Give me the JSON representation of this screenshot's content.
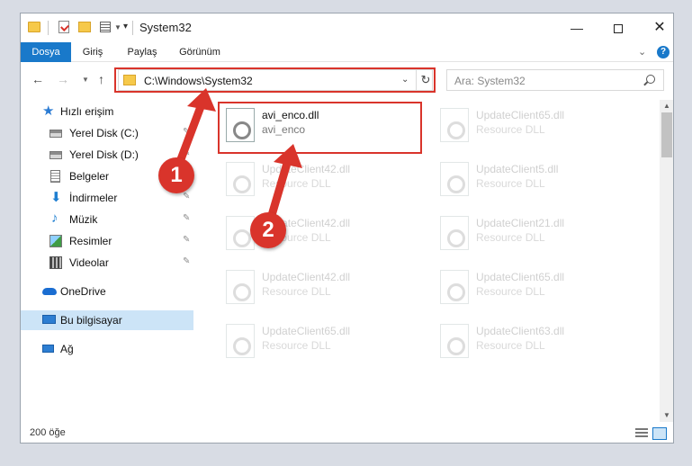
{
  "window": {
    "title": "System32",
    "min_glyph": "—",
    "close_glyph": "✕"
  },
  "ribbon": {
    "tabs": [
      {
        "label": "Dosya",
        "active": true
      },
      {
        "label": "Giriş"
      },
      {
        "label": "Paylaş"
      },
      {
        "label": "Görünüm"
      }
    ],
    "help_label": "?",
    "collapse_glyph": "⌄"
  },
  "nav": {
    "back_glyph": "←",
    "forward_glyph": "→",
    "recent_glyph": "▼",
    "up_glyph": "↑",
    "address": "C:\\Windows\\System32",
    "address_dropdown_glyph": "⌄",
    "refresh_glyph": "↻",
    "search_placeholder": "Ara: System32"
  },
  "sidebar": {
    "items": [
      {
        "label": "Hızlı erişim",
        "icon": "quick-access-icon",
        "glyph": "★"
      },
      {
        "label": "Yerel Disk (C:)",
        "icon": "local-disk-icon",
        "pinned": true
      },
      {
        "label": "Yerel Disk (D:)",
        "icon": "local-disk-icon",
        "pinned": true
      },
      {
        "label": "Belgeler",
        "icon": "documents-icon",
        "pinned": true
      },
      {
        "label": "İndirmeler",
        "icon": "downloads-icon",
        "glyph": "⬇",
        "pinned": true
      },
      {
        "label": "Müzik",
        "icon": "music-icon",
        "glyph": "♪",
        "pinned": true
      },
      {
        "label": "Resimler",
        "icon": "pictures-icon",
        "pinned": true
      },
      {
        "label": "Videolar",
        "icon": "videos-icon",
        "pinned": true
      },
      {
        "label": "OneDrive",
        "icon": "onedrive-icon"
      },
      {
        "label": "Bu bilgisayar",
        "icon": "this-pc-icon",
        "selected": true
      },
      {
        "label": "Ağ",
        "icon": "network-icon"
      }
    ],
    "pin_glyph": "📌"
  },
  "files": [
    {
      "name": "avi_enco.dll",
      "type": "avi_enco",
      "highlighted": true
    },
    {
      "name": "UpdateClient65.dll",
      "type": "Resource DLL"
    },
    {
      "name": "UpdateClient42.dll",
      "type": "Resource DLL"
    },
    {
      "name": "UpdateClient5.dll",
      "type": "Resource DLL"
    },
    {
      "name": "UpdateClient42.dll",
      "type": "Resource DLL"
    },
    {
      "name": "UpdateClient21.dll",
      "type": "Resource DLL"
    },
    {
      "name": "UpdateClient42.dll",
      "type": "Resource DLL"
    },
    {
      "name": "UpdateClient65.dll",
      "type": "Resource DLL"
    },
    {
      "name": "UpdateClient65.dll",
      "type": "Resource DLL"
    },
    {
      "name": "UpdateClient63.dll",
      "type": "Resource DLL"
    }
  ],
  "status": {
    "item_count": "200 öğe"
  },
  "annotations": {
    "step1": "1",
    "step2": "2",
    "color": "#d9342b"
  },
  "scroll": {
    "up_glyph": "▲",
    "down_glyph": "▼"
  }
}
